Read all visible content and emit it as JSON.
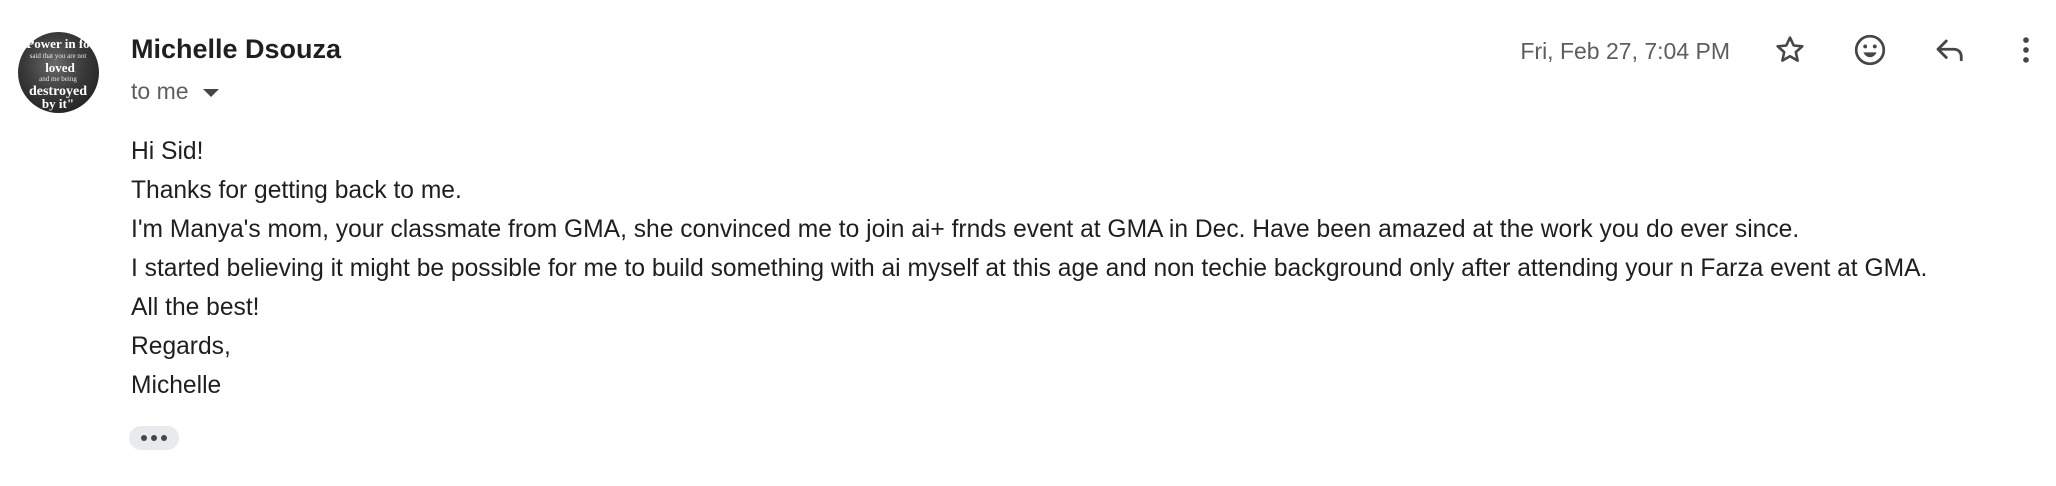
{
  "message": {
    "sender_name": "Michelle Dsouza",
    "recipient_label": "to me",
    "timestamp": "Fri, Feb 27, 7:04 PM",
    "body_lines": [
      "Hi Sid!",
      "Thanks for getting back to me.",
      "I'm Manya's mom, your classmate from GMA, she convinced me to join ai+ frnds event at GMA in Dec. Have been amazed at the work you do ever since.",
      "I started believing it might be possible for me to build something with ai myself at this age and non techie background only after attending your n Farza event at GMA.",
      "All the best!",
      "Regards,",
      "Michelle"
    ]
  },
  "avatar": {
    "text_lines": [
      "Power in fo",
      "said that you are not",
      "loved",
      "and me being",
      "destroyed",
      "by it\""
    ]
  },
  "actions": {
    "icons": [
      "star-icon",
      "emoji-icon",
      "reply-icon",
      "more-vert-icon"
    ]
  },
  "colors": {
    "text_primary": "#1f1f1f",
    "text_secondary": "#5e5e5e",
    "icon": "#444746",
    "pill_bg": "#e8eaed"
  }
}
